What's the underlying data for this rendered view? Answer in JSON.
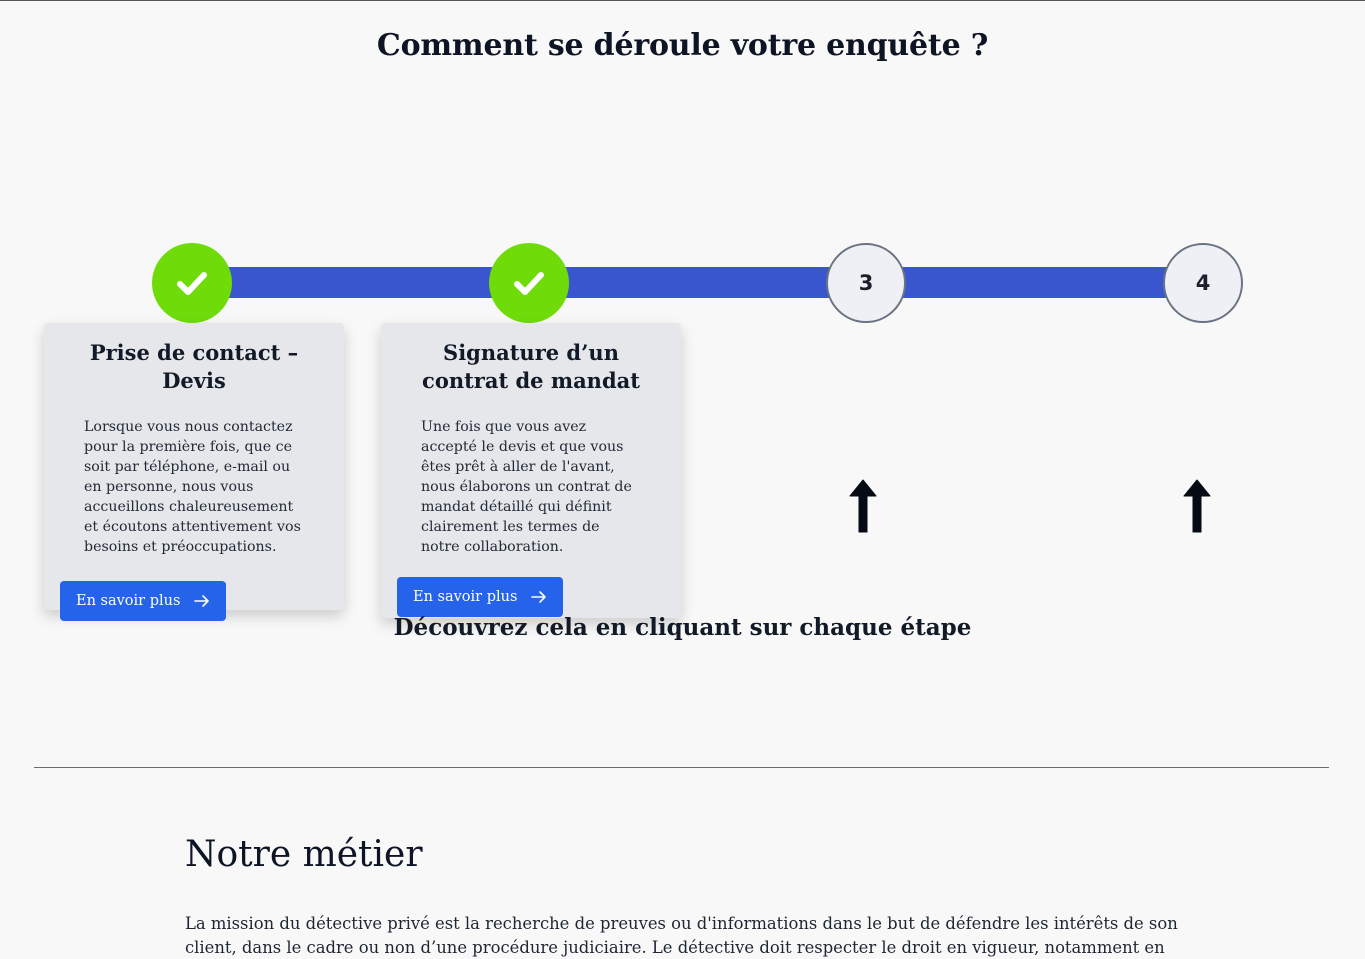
{
  "section": {
    "title": "Comment se déroule votre enquête ?",
    "discover": "Découvrez cela en cliquant sur chaque étape"
  },
  "colors": {
    "track": "#3a56cf",
    "done": "#6fdc0a",
    "button": "#2563eb"
  },
  "steps": [
    {
      "status": "done",
      "icon": "check-icon",
      "label": ""
    },
    {
      "status": "done",
      "icon": "check-icon",
      "label": ""
    },
    {
      "status": "pending",
      "label": "3"
    },
    {
      "status": "pending",
      "label": "4"
    }
  ],
  "cards": [
    {
      "title": "Prise de contact – Devis",
      "text": "Lorsque vous nous contactez pour la première fois, que ce soit par téléphone, e-mail ou en personne, nous vous accueillons chaleureusement et écoutons attentivement vos besoins et préoccupations.",
      "button": "En savoir plus"
    },
    {
      "title": "Signature d’un contrat de mandat",
      "text": "Une fois que vous avez accepté le devis et que vous êtes prêt à aller de l'avant, nous élaborons un contrat de mandat détaillé qui définit clairement les termes de notre collaboration.",
      "button": "En savoir plus"
    }
  ],
  "metier": {
    "title": "Notre métier",
    "text": "La mission du détective privé est la recherche de preuves ou d'informations dans le but de défendre les intérêts de son client, dans le cadre ou non d’une procédure judiciaire. Le détective doit respecter le droit en vigueur, notamment en ce qui concerne"
  }
}
